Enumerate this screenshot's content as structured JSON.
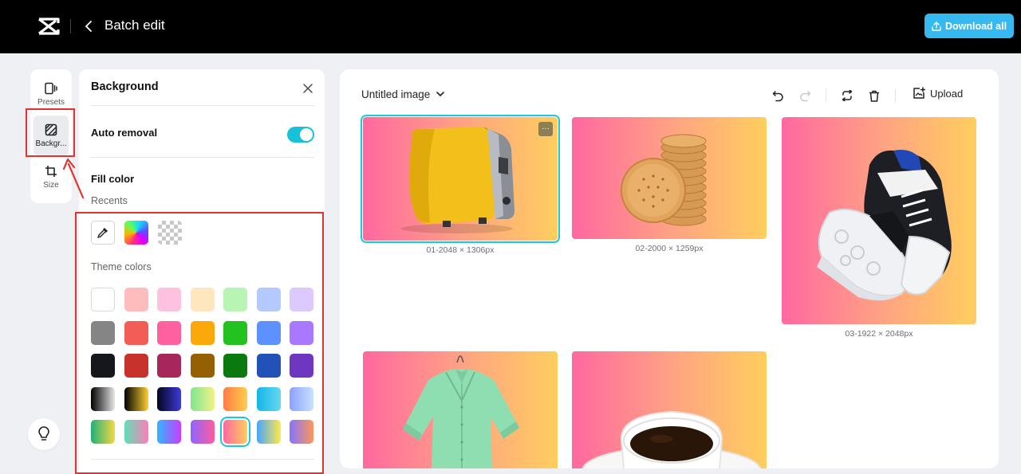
{
  "header": {
    "title": "Batch edit",
    "download_label": "Download all"
  },
  "rail": {
    "items": [
      {
        "label": "Presets"
      },
      {
        "label": "Backgr..."
      },
      {
        "label": "Size"
      }
    ]
  },
  "panel": {
    "title": "Background",
    "auto_removal_label": "Auto removal",
    "auto_removal_on": true,
    "fill_color_label": "Fill color",
    "recents_label": "Recents",
    "theme_colors_label": "Theme colors",
    "theme_colors": [
      [
        "#ffffff",
        "#ffbcbc",
        "#ffc2de",
        "#ffe6bf",
        "#b8f5b4",
        "#b4c9ff",
        "#dccaff"
      ],
      [
        "#858585",
        "#f25d55",
        "#ff609e",
        "#fba90a",
        "#23c220",
        "#5d91ff",
        "#a878ff"
      ],
      [
        "#15171c",
        "#c8322c",
        "#a8275a",
        "#946002",
        "#0b7a0e",
        "#2251b8",
        "#6f37c0"
      ]
    ],
    "theme_gradients": [
      [
        "#000000|#e8e8e8",
        "#000000|#ffcf31",
        "#050520|#3e3ad8",
        "#7fe58c|#f3f28a",
        "#ff7b47|#ffce4c",
        "#14b6e6|#66d7f0",
        "#8ca0ff|#c8e2ff"
      ],
      [
        "#20b07a|#f3d943",
        "#5ee0b8|#ff7db9",
        "#31b6ff|#cb3bff",
        "#8f65ff|#ff5c9c",
        "#ff68a0|#ffce5e",
        "#48a5ff|#ffe94a",
        "#8473ff|#ff9658"
      ]
    ],
    "selected_gradient": "#ff68a0|#ffce5e"
  },
  "canvas": {
    "image_name": "Untitled image",
    "upload_label": "Upload",
    "images": [
      {
        "caption": "01-2048 × 1306px",
        "subject": "toaster",
        "selected": true
      },
      {
        "caption": "02-2000 × 1259px",
        "subject": "crackers",
        "selected": false
      },
      {
        "caption": "03-1922 × 2048px",
        "subject": "sneaker",
        "selected": false
      },
      {
        "caption": "",
        "subject": "shirt",
        "selected": false
      },
      {
        "caption": "",
        "subject": "coffee",
        "selected": false
      }
    ]
  },
  "colors": {
    "accent": "#17c1d9",
    "download_bg": "#35b9f0",
    "annotation": "#e83030",
    "image_gradient_start": "#ff68a0",
    "image_gradient_end": "#ffce5e"
  }
}
